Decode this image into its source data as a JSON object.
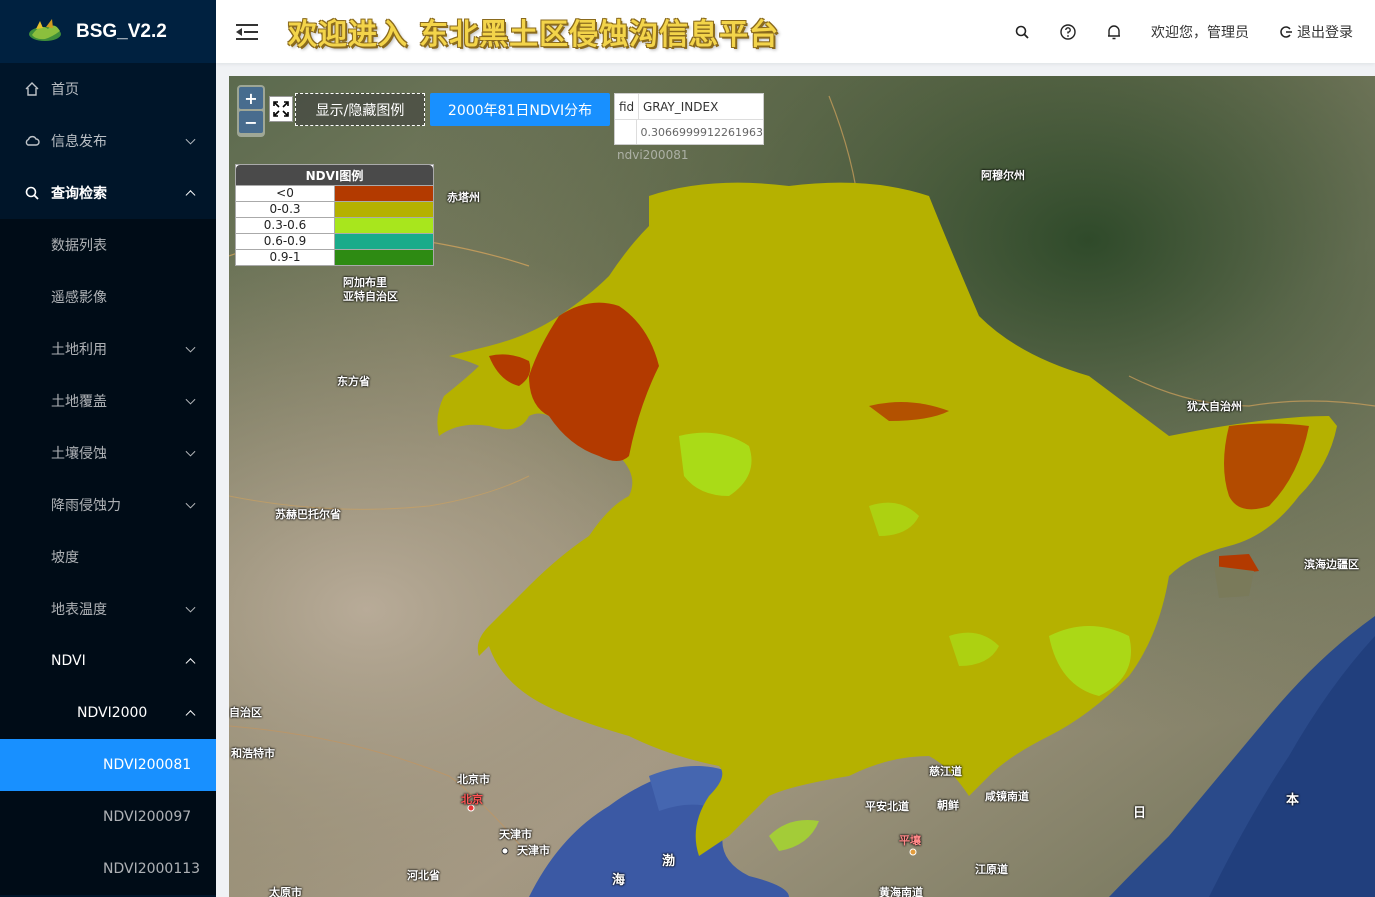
{
  "app": {
    "logo_text": "BSG_V2.2"
  },
  "header": {
    "title": "欢迎进入 东北黑土区侵蚀沟信息平台",
    "welcome": "欢迎您，管理员",
    "logout": "退出登录"
  },
  "sidebar": {
    "items": [
      {
        "label": "首页",
        "icon": "home-icon"
      },
      {
        "label": "信息发布",
        "icon": "cloud-icon"
      },
      {
        "label": "查询检索",
        "icon": "search-icon"
      }
    ],
    "sub": [
      {
        "label": "数据列表"
      },
      {
        "label": "遥感影像"
      },
      {
        "label": "土地利用"
      },
      {
        "label": "土地覆盖"
      },
      {
        "label": "土壤侵蚀"
      },
      {
        "label": "降雨侵蚀力"
      },
      {
        "label": "坡度"
      },
      {
        "label": "地表温度"
      },
      {
        "label": "NDVI"
      }
    ],
    "ndvi_group": "NDVI2000",
    "ndvi_items": [
      "NDVI200081",
      "NDVI200097",
      "NDVI2000113"
    ]
  },
  "map": {
    "zoom_in": "+",
    "zoom_out": "−",
    "toggle_legend": "显示/隐藏图例",
    "ndvi_button": "2000年81日NDVI分布",
    "info_table": {
      "col1": "fid",
      "col2": "GRAY_INDEX",
      "value": "0.3066999912261963"
    },
    "layer_name": "ndvi200081",
    "legend": {
      "title": "NDVI图例",
      "rows": [
        {
          "label": "<0",
          "color": "#b33a00"
        },
        {
          "label": "0-0.3",
          "color": "#b5b100"
        },
        {
          "label": "0.3-0.6",
          "color": "#a8e61d"
        },
        {
          "label": "0.6-0.9",
          "color": "#1aab8a"
        },
        {
          "label": "0.9-1",
          "color": "#2e8b13"
        }
      ]
    },
    "places": [
      "赤塔州",
      "阿穆尔州",
      "阿加布里\n亚特自治区",
      "东方省",
      "犹太自治州",
      "苏赫巴托尔省",
      "滨海边疆区",
      "自治区",
      "和浩特市",
      "北京市",
      "北京",
      "天津市",
      "天津市",
      "河北省",
      "太原市",
      "慈江道",
      "平安北道",
      "朝鲜",
      "咸镜南道",
      "平壤",
      "江原道",
      "黄海南道",
      "渤",
      "海",
      "日",
      "本"
    ]
  }
}
